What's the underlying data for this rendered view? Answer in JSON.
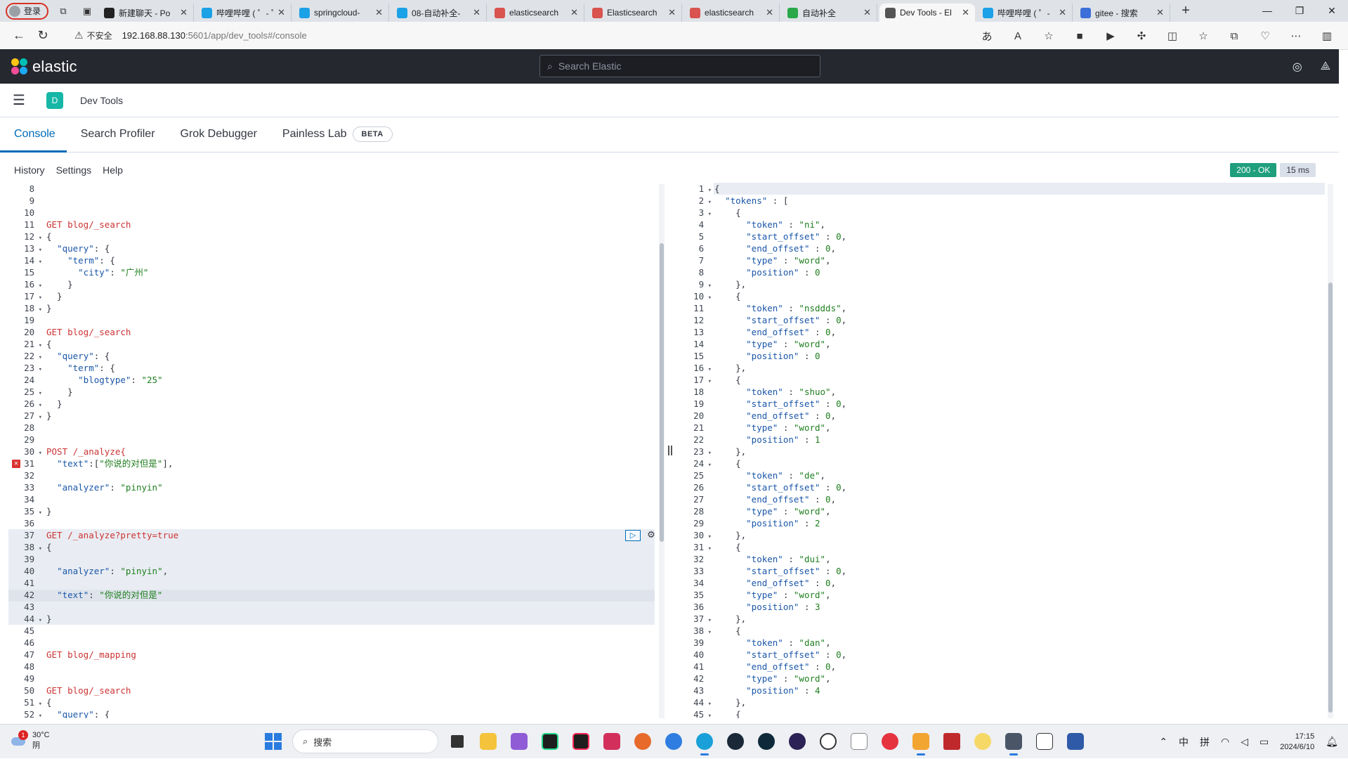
{
  "browser": {
    "profile_label": "登录",
    "tabs": [
      {
        "title": "新建聊天 - Po",
        "color": "#222"
      },
      {
        "title": "哔哩哔哩 ( ゜- ゜",
        "color": "#1aa1e6"
      },
      {
        "title": "springcloud-",
        "color": "#1aa1e6"
      },
      {
        "title": "08-自动补全-",
        "color": "#1aa1e6"
      },
      {
        "title": "elasticsearch",
        "color": "#d9534f"
      },
      {
        "title": "Elasticsearch",
        "color": "#d9534f"
      },
      {
        "title": "elasticsearch",
        "color": "#d9534f"
      },
      {
        "title": "自动补全",
        "color": "#2aa84a"
      },
      {
        "title": "Dev Tools - El",
        "color": "#555"
      },
      {
        "title": "哔哩哔哩 ( ゜-",
        "color": "#1aa1e6"
      },
      {
        "title": "gitee - 搜索",
        "color": "#3d6fd8"
      }
    ],
    "insecure_label": "不安全",
    "url_host": "192.168.88.130",
    "url_rest": ":5601/app/dev_tools#/console"
  },
  "kibana": {
    "brand": "elastic",
    "search_placeholder": "Search Elastic",
    "space_initial": "D",
    "breadcrumb": "Dev Tools",
    "tabs": [
      "Console",
      "Search Profiler",
      "Grok Debugger",
      "Painless Lab"
    ],
    "beta_label": "BETA",
    "console_menu": [
      "History",
      "Settings",
      "Help"
    ],
    "status_code": "200 - OK",
    "status_time": "15 ms"
  },
  "editor": {
    "lines": [
      {
        "n": "8",
        "text": ""
      },
      {
        "n": "9",
        "text": ""
      },
      {
        "n": "10",
        "text": ""
      },
      {
        "n": "11",
        "text": "GET blog/_search"
      },
      {
        "n": "12",
        "fold": true,
        "text": "{"
      },
      {
        "n": "13",
        "fold": true,
        "text": "  \"query\": {"
      },
      {
        "n": "14",
        "fold": true,
        "text": "    \"term\": {"
      },
      {
        "n": "15",
        "text": "      \"city\": \"广州\""
      },
      {
        "n": "16",
        "fold": true,
        "text": "    }"
      },
      {
        "n": "17",
        "fold": true,
        "text": "  }"
      },
      {
        "n": "18",
        "fold": true,
        "text": "}"
      },
      {
        "n": "19",
        "text": ""
      },
      {
        "n": "20",
        "text": "GET blog/_search"
      },
      {
        "n": "21",
        "fold": true,
        "text": "{"
      },
      {
        "n": "22",
        "fold": true,
        "text": "  \"query\": {"
      },
      {
        "n": "23",
        "fold": true,
        "text": "    \"term\": {"
      },
      {
        "n": "24",
        "text": "      \"blogtype\": \"25\""
      },
      {
        "n": "25",
        "fold": true,
        "text": "    }"
      },
      {
        "n": "26",
        "fold": true,
        "text": "  }"
      },
      {
        "n": "27",
        "fold": true,
        "text": "}"
      },
      {
        "n": "28",
        "text": ""
      },
      {
        "n": "29",
        "text": ""
      },
      {
        "n": "30",
        "fold": true,
        "text": "POST /_analyze{"
      },
      {
        "n": "31",
        "error": true,
        "text": "  \"text\":[\"你说的对但是\"],"
      },
      {
        "n": "32",
        "text": ""
      },
      {
        "n": "33",
        "text": "  \"analyzer\":\"pinyin\""
      },
      {
        "n": "34",
        "text": ""
      },
      {
        "n": "35",
        "fold": true,
        "text": "}"
      },
      {
        "n": "36",
        "text": ""
      },
      {
        "n": "37",
        "text": "GET /_analyze?pretty=true"
      },
      {
        "n": "38",
        "fold": true,
        "text": "{"
      },
      {
        "n": "39",
        "text": ""
      },
      {
        "n": "40",
        "text": "  \"analyzer\": \"pinyin\","
      },
      {
        "n": "41",
        "text": ""
      },
      {
        "n": "42",
        "text": "  \"text\": \"你说的对但是\""
      },
      {
        "n": "43",
        "text": ""
      },
      {
        "n": "44",
        "fold": true,
        "text": "}"
      },
      {
        "n": "45",
        "text": ""
      },
      {
        "n": "46",
        "text": ""
      },
      {
        "n": "47",
        "text": "GET blog/_mapping"
      },
      {
        "n": "48",
        "text": ""
      },
      {
        "n": "49",
        "text": ""
      },
      {
        "n": "50",
        "text": "GET blog/_search"
      },
      {
        "n": "51",
        "fold": true,
        "text": "{"
      },
      {
        "n": "52",
        "fold": true,
        "text": "  \"query\": {"
      }
    ]
  },
  "response": {
    "lines": [
      {
        "n": "1",
        "fold": true,
        "text": "{"
      },
      {
        "n": "2",
        "fold": true,
        "text": "  \"tokens\" : ["
      },
      {
        "n": "3",
        "fold": true,
        "text": "    {"
      },
      {
        "n": "4",
        "text": "      \"token\" : \"ni\","
      },
      {
        "n": "5",
        "text": "      \"start_offset\" : 0,"
      },
      {
        "n": "6",
        "text": "      \"end_offset\" : 0,"
      },
      {
        "n": "7",
        "text": "      \"type\" : \"word\","
      },
      {
        "n": "8",
        "text": "      \"position\" : 0"
      },
      {
        "n": "9",
        "fold": true,
        "text": "    },"
      },
      {
        "n": "10",
        "fold": true,
        "text": "    {"
      },
      {
        "n": "11",
        "text": "      \"token\" : \"nsddds\","
      },
      {
        "n": "12",
        "text": "      \"start_offset\" : 0,"
      },
      {
        "n": "13",
        "text": "      \"end_offset\" : 0,"
      },
      {
        "n": "14",
        "text": "      \"type\" : \"word\","
      },
      {
        "n": "15",
        "text": "      \"position\" : 0"
      },
      {
        "n": "16",
        "fold": true,
        "text": "    },"
      },
      {
        "n": "17",
        "fold": true,
        "text": "    {"
      },
      {
        "n": "18",
        "text": "      \"token\" : \"shuo\","
      },
      {
        "n": "19",
        "text": "      \"start_offset\" : 0,"
      },
      {
        "n": "20",
        "text": "      \"end_offset\" : 0,"
      },
      {
        "n": "21",
        "text": "      \"type\" : \"word\","
      },
      {
        "n": "22",
        "text": "      \"position\" : 1"
      },
      {
        "n": "23",
        "fold": true,
        "text": "    },"
      },
      {
        "n": "24",
        "fold": true,
        "text": "    {"
      },
      {
        "n": "25",
        "text": "      \"token\" : \"de\","
      },
      {
        "n": "26",
        "text": "      \"start_offset\" : 0,"
      },
      {
        "n": "27",
        "text": "      \"end_offset\" : 0,"
      },
      {
        "n": "28",
        "text": "      \"type\" : \"word\","
      },
      {
        "n": "29",
        "text": "      \"position\" : 2"
      },
      {
        "n": "30",
        "fold": true,
        "text": "    },"
      },
      {
        "n": "31",
        "fold": true,
        "text": "    {"
      },
      {
        "n": "32",
        "text": "      \"token\" : \"dui\","
      },
      {
        "n": "33",
        "text": "      \"start_offset\" : 0,"
      },
      {
        "n": "34",
        "text": "      \"end_offset\" : 0,"
      },
      {
        "n": "35",
        "text": "      \"type\" : \"word\","
      },
      {
        "n": "36",
        "text": "      \"position\" : 3"
      },
      {
        "n": "37",
        "fold": true,
        "text": "    },"
      },
      {
        "n": "38",
        "fold": true,
        "text": "    {"
      },
      {
        "n": "39",
        "text": "      \"token\" : \"dan\","
      },
      {
        "n": "40",
        "text": "      \"start_offset\" : 0,"
      },
      {
        "n": "41",
        "text": "      \"end_offset\" : 0,"
      },
      {
        "n": "42",
        "text": "      \"type\" : \"word\","
      },
      {
        "n": "43",
        "text": "      \"position\" : 4"
      },
      {
        "n": "44",
        "fold": true,
        "text": "    },"
      },
      {
        "n": "45",
        "fold": true,
        "text": "    {"
      }
    ]
  },
  "taskbar": {
    "temperature": "30°C",
    "weather": "阴",
    "weather_badge": "1",
    "search_label": "搜索",
    "ime_lang": "中",
    "ime_mode": "拼",
    "time": "17:15",
    "date": "2024/6/10"
  }
}
